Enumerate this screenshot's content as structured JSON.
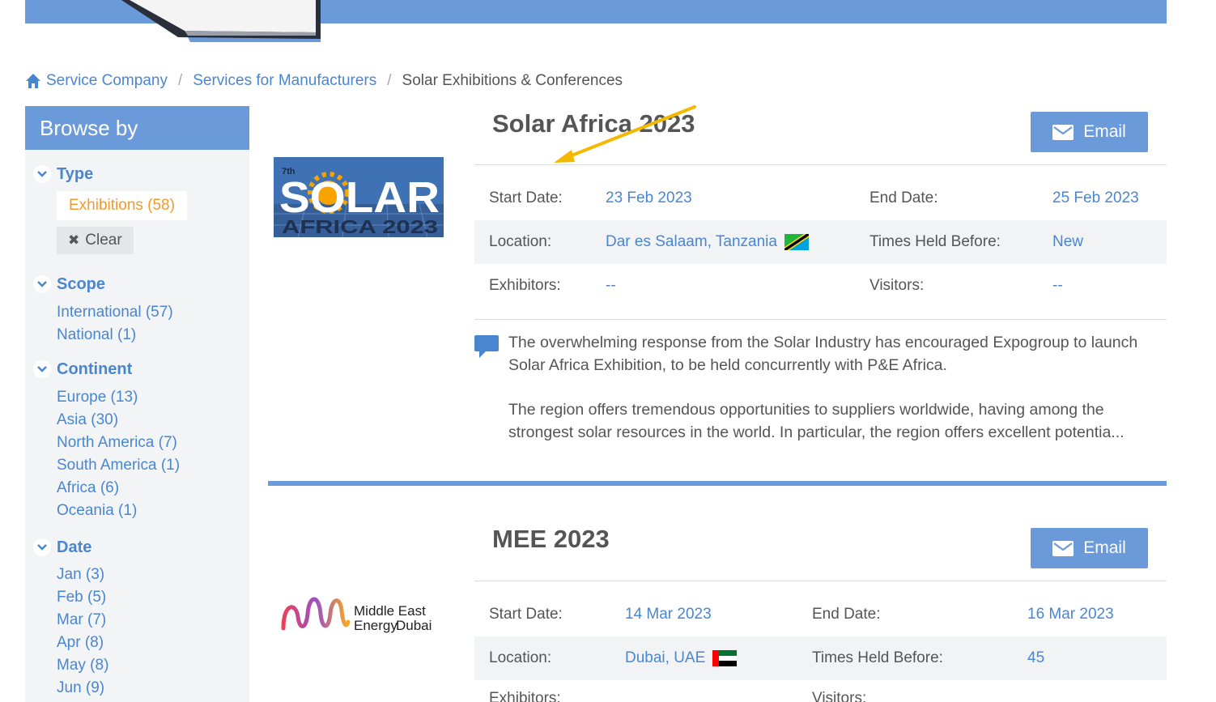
{
  "breadcrumb": {
    "home": "Service Company",
    "level2": "Services for Manufacturers",
    "current": "Solar Exhibitions & Conferences"
  },
  "sidebar": {
    "heading": "Browse by",
    "type": {
      "title": "Type",
      "active": "Exhibitions (58)",
      "clear": "Clear"
    },
    "scope": {
      "title": "Scope",
      "items": [
        "International (57)",
        "National (1)"
      ]
    },
    "continent": {
      "title": "Continent",
      "items": [
        "Europe (13)",
        "Asia (30)",
        "North America (7)",
        "South America (1)",
        "Africa (6)",
        "Oceania (1)"
      ]
    },
    "date": {
      "title": "Date",
      "items": [
        "Jan (3)",
        "Feb (5)",
        "Mar (7)",
        "Apr (8)",
        "May (8)",
        "Jun (9)"
      ]
    }
  },
  "events": [
    {
      "title": "Solar Africa 2023",
      "email_label": "Email",
      "logo": {
        "superscript": "7th",
        "word": "SOLAR",
        "sub": "AFRICA 2023"
      },
      "labels": {
        "start": "Start Date:",
        "end": "End Date:",
        "location": "Location:",
        "times": "Times Held Before:",
        "exhibitors": "Exhibitors:",
        "visitors": "Visitors:"
      },
      "start_date": "23 Feb 2023",
      "end_date": "25 Feb 2023",
      "location": "Dar es Salaam, Tanzania",
      "times_held": "New",
      "exhibitors": "--",
      "visitors": "--",
      "description": [
        "The overwhelming response from the Solar Industry has encouraged Expogroup to launch Solar Africa Exhibition, to be held concurrently with P&E Africa.",
        "The region offers tremendous opportunities to suppliers worldwide, having among the strongest solar resources in the world. In particular, the region offers excellent potentia..."
      ]
    },
    {
      "title": "MEE 2023",
      "email_label": "Email",
      "logo": {
        "line1": "Middle East",
        "line2a": "Energy",
        "line2b": "Dubai"
      },
      "labels": {
        "start": "Start Date:",
        "end": "End Date:",
        "location": "Location:",
        "times": "Times Held Before:",
        "exhibitors": "Exhibitors:",
        "visitors": "Visitors:"
      },
      "start_date": "14 Mar 2023",
      "end_date": "16 Mar 2023",
      "location": "Dubai, UAE",
      "times_held": "45"
    }
  ],
  "colors": {
    "accent": "#6a9ad9",
    "link": "#4a86d0",
    "active": "#f39a28",
    "arrow": "#f5b800"
  }
}
